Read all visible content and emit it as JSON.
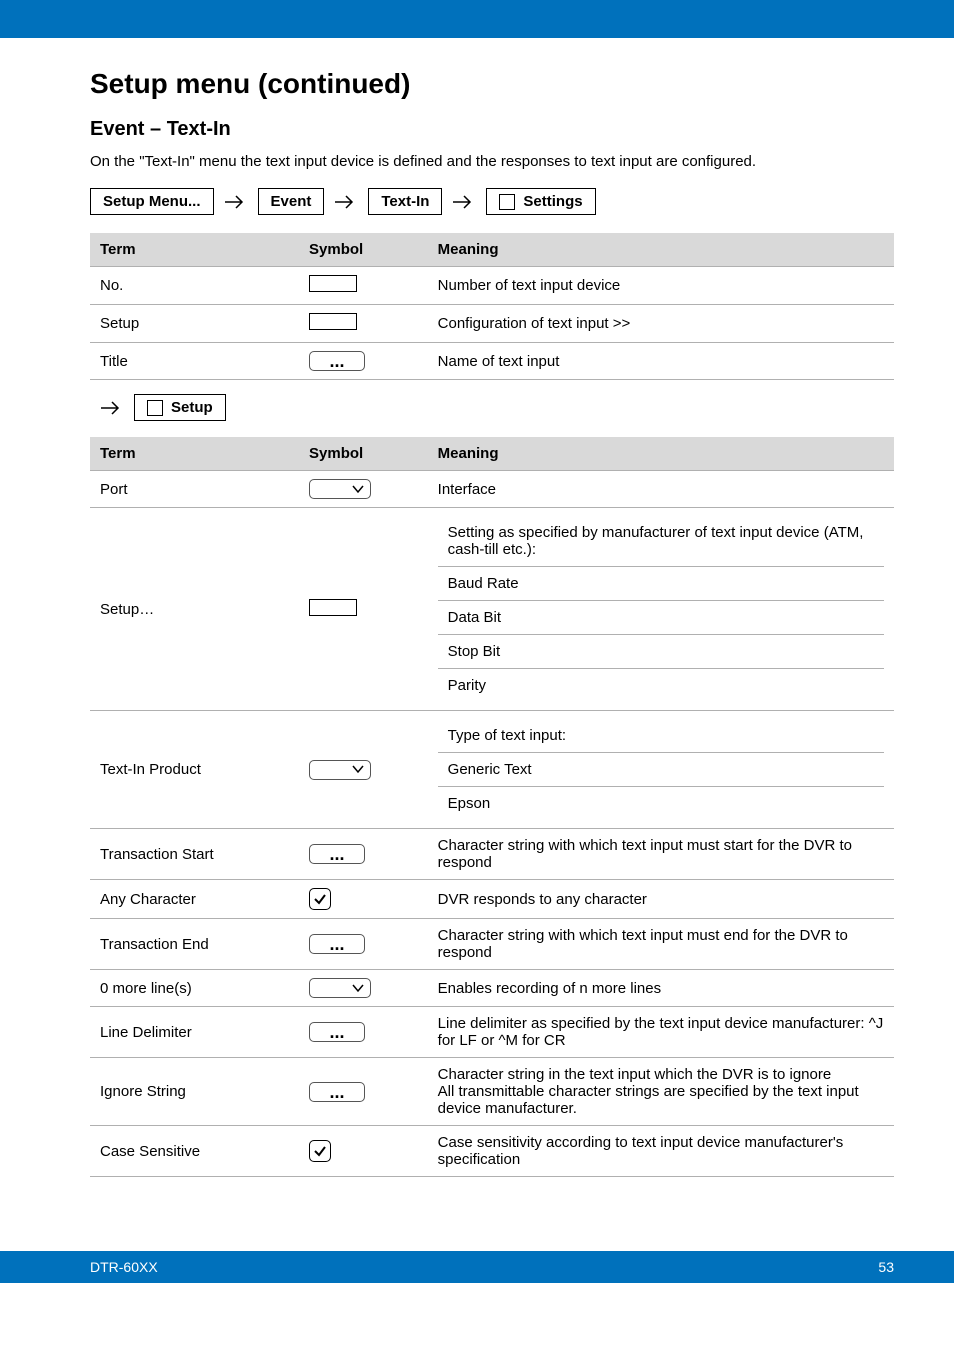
{
  "page_title": "Setup menu (continued)",
  "section_title": "Event – Text-In",
  "intro_text": "On the \"Text-In\" menu the text input device is defined and the responses to text input are configured.",
  "nav": {
    "setup_menu": "Setup Menu...",
    "event": "Event",
    "text_in": "Text-In",
    "settings": "Settings"
  },
  "table_headers": {
    "term": "Term",
    "symbol": "Symbol",
    "meaning": "Meaning"
  },
  "ellipsis": "...",
  "table1": {
    "rows": [
      {
        "term": "No.",
        "meaning": "Number of text input device"
      },
      {
        "term": "Setup",
        "meaning": "Configuration of text input >>"
      },
      {
        "term": "Title",
        "meaning": "Name of text input"
      }
    ]
  },
  "sub_nav_label": "Setup",
  "table2": {
    "port": {
      "term": "Port",
      "meaning": "Interface"
    },
    "setup": {
      "term": "Setup…",
      "cells": [
        "Setting as specified by manufacturer of text input device (ATM, cash-till etc.):",
        "Baud Rate",
        "Data Bit",
        "Stop Bit",
        "Parity"
      ]
    },
    "text_in_product": {
      "term": "Text-In Product",
      "cells": [
        "Type of text input:",
        "Generic Text",
        "Epson"
      ]
    },
    "transaction_start": {
      "term": "Transaction Start",
      "meaning": "Character string with which text input must start for the DVR to respond"
    },
    "any_character": {
      "term": "Any Character",
      "meaning": "DVR responds to any character"
    },
    "transaction_end": {
      "term": "Transaction End",
      "meaning": "Character string with which text input must end for the DVR to respond"
    },
    "more_lines": {
      "term": "0 more line(s)",
      "meaning": "Enables recording of n more lines"
    },
    "line_delimiter": {
      "term": "Line Delimiter",
      "meaning": "Line delimiter as specified by the text input device manufacturer: ^J for LF or ^M for CR"
    },
    "ignore_string": {
      "term": "Ignore String",
      "meaning": "Character string in the text input which the DVR is to ignore\nAll transmittable character strings are specified by the text input device manufacturer."
    },
    "case_sensitive": {
      "term": "Case Sensitive",
      "meaning": "Case sensitivity according to text input device manufacturer's specification"
    }
  },
  "footer": {
    "left": "DTR-60XX",
    "right": "53"
  }
}
